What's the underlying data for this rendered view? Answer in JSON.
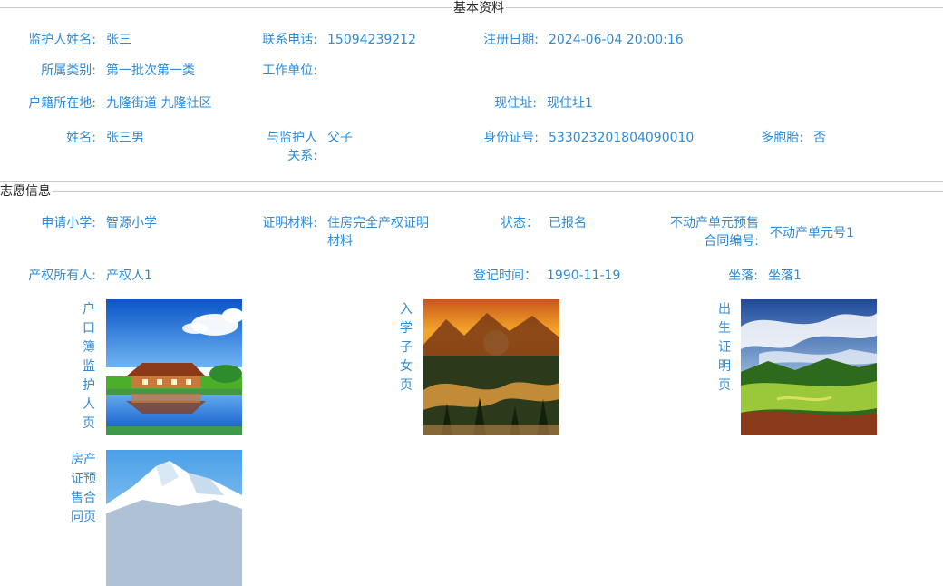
{
  "basic": {
    "section_title": "基本资料",
    "guardian_name_label": "监护人姓名:",
    "guardian_name": "张三",
    "phone_label": "联系电话:",
    "phone": "15094239212",
    "reg_date_label": "注册日期:",
    "reg_date": "2024-06-04 20:00:16",
    "category_label": "所属类别:",
    "category": "第一批次第一类",
    "workplace_label": "工作单位:",
    "workplace": "",
    "household_label": "户籍所在地:",
    "household": "九隆街道 九隆社区",
    "address_label": "现住址:",
    "address": "现住址1",
    "name_label": "姓名:",
    "name": "张三男",
    "relation_label": "与监护人关系:",
    "relation": "父子",
    "idcard_label": "身份证号:",
    "idcard": "533023201804090010",
    "multi_label": "多胞胎:",
    "multi": "否"
  },
  "wish": {
    "section_title": "志愿信息",
    "school_label": "申请小学:",
    "school": "智源小学",
    "proof_label": "证明材料:",
    "proof": "住房完全产权证明材料",
    "status_label": "状态：",
    "status": "已报名",
    "contract_label": "不动产单元预售合同编号:",
    "contract": "不动产单元号1",
    "owner_label": "产权所有人:",
    "owner": "产权人1",
    "regtime_label": "登记时间：",
    "regtime": "1990-11-19",
    "location_label": "坐落:",
    "location": "坐落1"
  },
  "images": {
    "hukou_label": "户口簿监护人页",
    "enroll_label": "入学子女页",
    "birth_label": "出生证明页",
    "contract_label": "房产证预售合同页"
  }
}
